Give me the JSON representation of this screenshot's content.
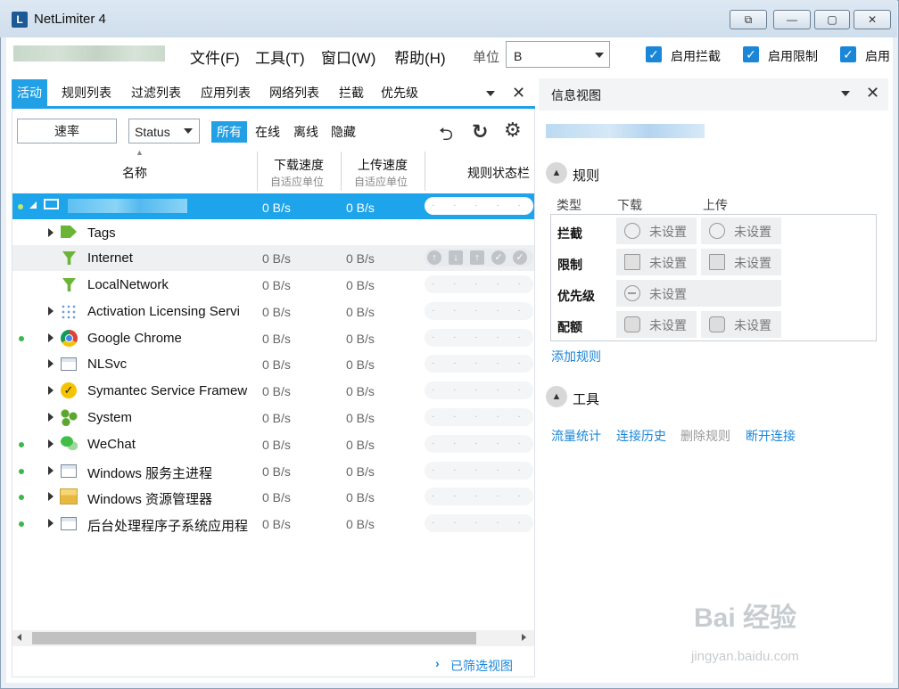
{
  "window": {
    "title": "NetLimiter 4",
    "controls": [
      "⧉",
      "—",
      "▢",
      "✕"
    ]
  },
  "menu": {
    "items": [
      "文件(F)",
      "工具(T)",
      "窗口(W)",
      "帮助(H)"
    ]
  },
  "unit": {
    "label": "单位",
    "value": "B"
  },
  "toggles": [
    {
      "label": "启用拦截",
      "checked": true
    },
    {
      "label": "启用限制",
      "checked": true
    },
    {
      "label": "启用",
      "checked": true
    }
  ],
  "left_tabs": [
    "活动",
    "规则列表",
    "过滤列表",
    "应用列表",
    "网络列表",
    "拦截",
    "优先级"
  ],
  "filters": {
    "search_value": "速率",
    "status_value": "Status",
    "modes": [
      "所有",
      "在线",
      "离线",
      "隐藏"
    ]
  },
  "columns": {
    "name": "名称",
    "down": "下载速度",
    "down_sub": "自适应单位",
    "up": "上传速度",
    "up_sub": "自适应单位",
    "rules": "规则状态栏"
  },
  "rows": [
    {
      "name": "Tags",
      "down": "",
      "up": ""
    },
    {
      "name": "Internet",
      "down": "0 B/s",
      "up": "0 B/s"
    },
    {
      "name": "LocalNetwork",
      "down": "0 B/s",
      "up": "0 B/s"
    },
    {
      "name": "Activation Licensing Servi",
      "down": "0 B/s",
      "up": "0 B/s"
    },
    {
      "name": "Google Chrome",
      "down": "0 B/s",
      "up": "0 B/s"
    },
    {
      "name": "NLSvc",
      "down": "0 B/s",
      "up": "0 B/s"
    },
    {
      "name": "Symantec Service Framew",
      "down": "0 B/s",
      "up": "0 B/s"
    },
    {
      "name": "System",
      "down": "0 B/s",
      "up": "0 B/s"
    },
    {
      "name": "WeChat",
      "down": "0 B/s",
      "up": "0 B/s"
    },
    {
      "name": "Windows 服务主进程",
      "down": "0 B/s",
      "up": "0 B/s"
    },
    {
      "name": "Windows 资源管理器",
      "down": "0 B/s",
      "up": "0 B/s"
    },
    {
      "name": "后台处理程序子系统应用程",
      "down": "0 B/s",
      "up": "0 B/s"
    }
  ],
  "root_row": {
    "down": "0 B/s",
    "up": "0 B/s"
  },
  "footer": {
    "filtered_view": "已筛选视图"
  },
  "info_panel": {
    "title": "信息视图",
    "rules_section": "规则",
    "col_type": "类型",
    "col_down": "下载",
    "col_up": "上传",
    "rule_rows": [
      {
        "label": "拦截",
        "down": "未设置",
        "up": "未设置"
      },
      {
        "label": "限制",
        "down": "未设置",
        "up": "未设置"
      },
      {
        "label": "优先级",
        "down": "未设置"
      },
      {
        "label": "配额",
        "down": "未设置",
        "up": "未设置"
      }
    ],
    "add_rule": "添加规则",
    "tools_section": "工具",
    "tools": [
      "流量统计",
      "连接历史",
      "删除规则",
      "断开连接"
    ]
  },
  "watermark": {
    "text": "Bai 经验",
    "url": "jingyan.baidu.com"
  },
  "colors": {
    "accent": "#21a0e6",
    "selected_row": "#1ea4ea",
    "link": "#1a86d8"
  }
}
